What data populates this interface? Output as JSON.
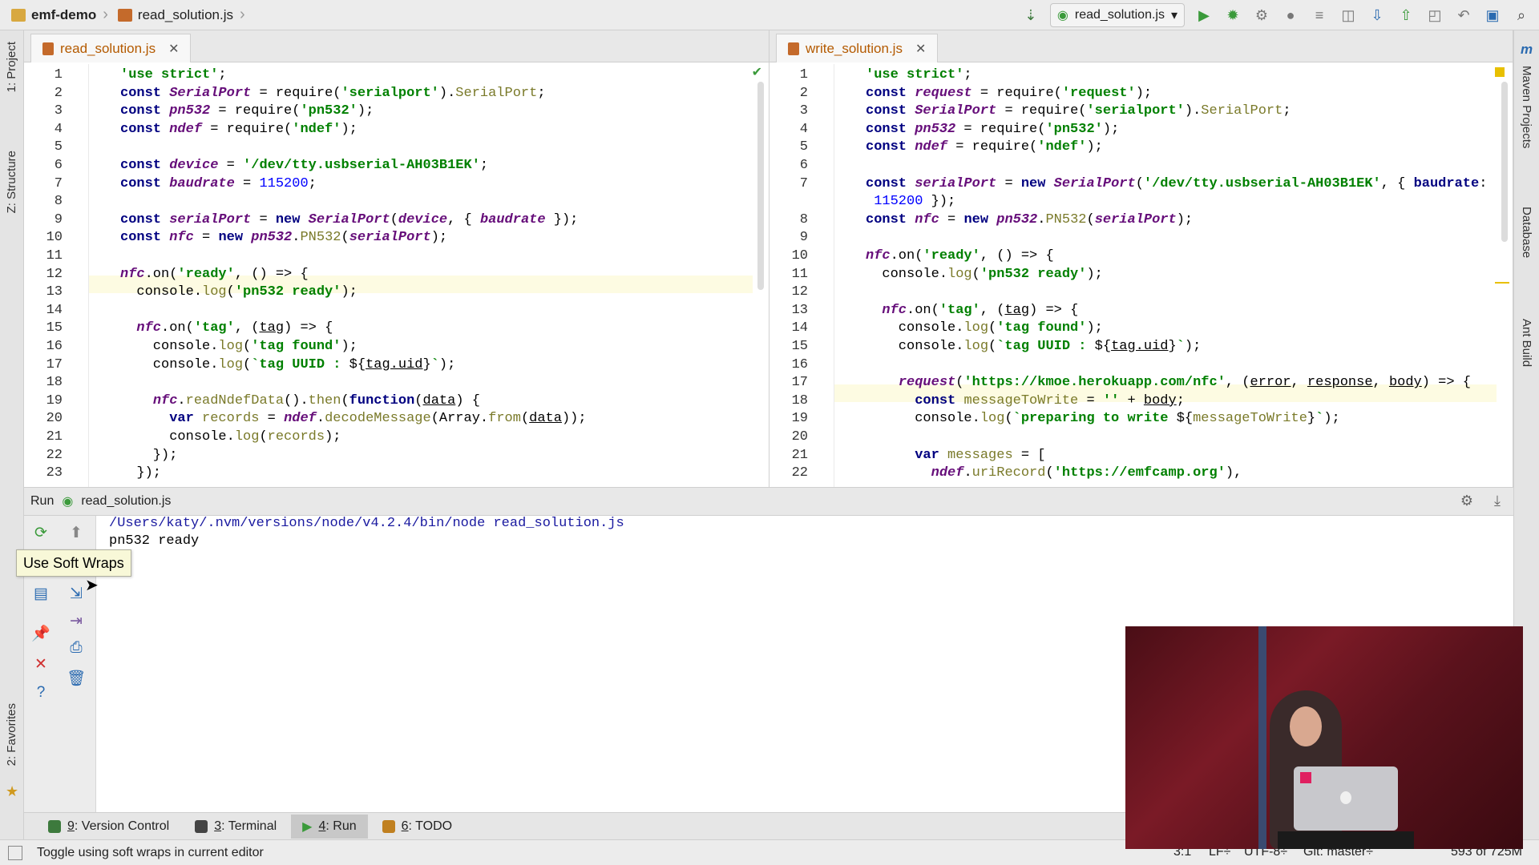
{
  "navbar": {
    "project": "emf-demo",
    "file": "read_solution.js",
    "run_config": "read_solution.js"
  },
  "left_strip": {
    "project": "1: Project",
    "structure": "Z: Structure",
    "favorites": "2: Favorites"
  },
  "right_strip": {
    "maven": "Maven Projects",
    "database": "Database",
    "ant": "Ant Build"
  },
  "left_editor": {
    "tab": "read_solution.js",
    "lines": [
      {
        "n": "1",
        "html": "<span class='str'>'use strict'</span>;"
      },
      {
        "n": "2",
        "html": "<span class='kw'>const</span> <span class='it'>SerialPort</span> = require(<span class='str'>'serialport'</span>).<span class='fn'>SerialPort</span>;"
      },
      {
        "n": "3",
        "html": "<span class='kw'>const</span> <span class='it'>pn532</span> = require(<span class='str'>'pn532'</span>);"
      },
      {
        "n": "4",
        "html": "<span class='kw'>const</span> <span class='it'>ndef</span> = require(<span class='str'>'ndef'</span>);"
      },
      {
        "n": "5",
        "html": ""
      },
      {
        "n": "6",
        "html": "<span class='kw'>const</span> <span class='it'>device</span> = <span class='str'>'/dev/tty.usbserial-AH03B1EK'</span>;"
      },
      {
        "n": "7",
        "html": "<span class='kw'>const</span> <span class='it'>baudrate</span> = <span class='num'>115200</span>;"
      },
      {
        "n": "8",
        "html": ""
      },
      {
        "n": "9",
        "html": "<span class='kw'>const</span> <span class='it'>serialPort</span> = <span class='kw'>new</span> <span class='it'>SerialPort</span>(<span class='it'>device</span>, { <span class='it'>baudrate</span> });"
      },
      {
        "n": "10",
        "html": "<span class='kw'>const</span> <span class='it'>nfc</span> = <span class='kw'>new</span> <span class='it'>pn532</span>.<span class='fn'>PN532</span>(<span class='it'>serialPort</span>);"
      },
      {
        "n": "11",
        "html": ""
      },
      {
        "n": "12",
        "html": "<span class='it'>nfc</span>.on(<span class='str'>'ready'</span>, () => {"
      },
      {
        "n": "13",
        "html": "  console.<span class='fn'>log</span>(<span class='str'>'pn532 ready'</span>);"
      },
      {
        "n": "14",
        "html": ""
      },
      {
        "n": "15",
        "html": "  <span class='it'>nfc</span>.on(<span class='str'>'tag'</span>, (<span class='u'>tag</span>) => {"
      },
      {
        "n": "16",
        "html": "    console.<span class='fn'>log</span>(<span class='str'>'tag found'</span>);"
      },
      {
        "n": "17",
        "html": "    console.<span class='fn'>log</span>(<span class='str'>`tag UUID : </span>${<span class='u'>tag.uid</span>}<span class='str'>`</span>);"
      },
      {
        "n": "18",
        "html": ""
      },
      {
        "n": "19",
        "html": "    <span class='it'>nfc</span>.<span class='fn'>readNdefData</span>().<span class='fn'>then</span>(<span class='kw'>function</span>(<span class='u'>data</span>) {"
      },
      {
        "n": "20",
        "html": "      <span class='kw'>var</span> <span class='fn'>records</span> = <span class='it'>ndef</span>.<span class='fn'>decodeMessage</span>(Array.<span class='fn'>from</span>(<span class='u'>data</span>));"
      },
      {
        "n": "21",
        "html": "      console.<span class='fn'>log</span>(<span class='fn'>records</span>);"
      },
      {
        "n": "22",
        "html": "    });"
      },
      {
        "n": "23",
        "html": "  });"
      }
    ]
  },
  "right_editor": {
    "tab": "write_solution.js",
    "lines": [
      {
        "n": "1",
        "html": "<span class='str'>'use strict'</span>;"
      },
      {
        "n": "2",
        "html": "<span class='kw'>const</span> <span class='it'>request</span> = require(<span class='str'>'request'</span>);"
      },
      {
        "n": "3",
        "html": "<span class='kw'>const</span> <span class='it'>SerialPort</span> = require(<span class='str'>'serialport'</span>).<span class='fn'>SerialPort</span>;"
      },
      {
        "n": "4",
        "html": "<span class='kw'>const</span> <span class='it'>pn532</span> = require(<span class='str'>'pn532'</span>);"
      },
      {
        "n": "5",
        "html": "<span class='kw'>const</span> <span class='it'>ndef</span> = require(<span class='str'>'ndef'</span>);"
      },
      {
        "n": "6",
        "html": ""
      },
      {
        "n": "7",
        "html": "<span class='kw'>const</span> <span class='it'>serialPort</span> = <span class='kw'>new</span> <span class='it'>SerialPort</span>(<span class='str'>'/dev/tty.usbserial-AH03B1EK'</span>, { <span class='kw'>baudrate</span>:"
      },
      {
        "n": "",
        "html": " <span class='num'>115200</span> });"
      },
      {
        "n": "8",
        "html": "<span class='kw'>const</span> <span class='it'>nfc</span> = <span class='kw'>new</span> <span class='it'>pn532</span>.<span class='fn'>PN532</span>(<span class='it'>serialPort</span>);"
      },
      {
        "n": "9",
        "html": ""
      },
      {
        "n": "10",
        "html": "<span class='it'>nfc</span>.on(<span class='str'>'ready'</span>, () => {"
      },
      {
        "n": "11",
        "html": "  console.<span class='fn'>log</span>(<span class='str'>'pn532 ready'</span>);"
      },
      {
        "n": "12",
        "html": ""
      },
      {
        "n": "13",
        "html": "  <span class='it'>nfc</span>.on(<span class='str'>'tag'</span>, (<span class='u'>tag</span>) => {"
      },
      {
        "n": "14",
        "html": "    console.<span class='fn'>log</span>(<span class='str'>'tag found'</span>);"
      },
      {
        "n": "15",
        "html": "    console.<span class='fn'>log</span>(<span class='str'>`tag UUID : </span>${<span class='u'>tag.uid</span>}<span class='str'>`</span>);"
      },
      {
        "n": "16",
        "html": ""
      },
      {
        "n": "17",
        "html": "    <span class='it'>request</span>(<span class='str'>'https://kmoe.herokuapp.com/nfc'</span>, (<span class='u'>error</span>, <span class='u'>response</span>, <span class='u'>body</span>) => {"
      },
      {
        "n": "18",
        "html": "      <span class='kw'>const</span> <span class='fn'>messageToWrite</span> = <span class='str'>''</span> + <span class='u'>body</span>;"
      },
      {
        "n": "19",
        "html": "      console.<span class='fn'>log</span>(<span class='str'>`preparing to write </span>${<span class='fn'>messageToWrite</span>}<span class='str'>`</span>);"
      },
      {
        "n": "20",
        "html": ""
      },
      {
        "n": "21",
        "html": "      <span class='kw'>var</span> <span class='fn'>messages</span> = ["
      },
      {
        "n": "22",
        "html": "        <span class='it'>ndef</span>.<span class='fn'>uriRecord</span>(<span class='str'>'https://emfcamp.org'</span>),"
      }
    ]
  },
  "run_panel": {
    "label": "Run",
    "config": "read_solution.js",
    "console": [
      "/Users/katy/.nvm/versions/node/v4.2.4/bin/node read_solution.js",
      "pn532 ready"
    ],
    "tooltip": "Use Soft Wraps"
  },
  "bottom_tools": [
    {
      "key": "9",
      "label": ": Version Control",
      "color": "#3d7a3d"
    },
    {
      "key": "3",
      "label": ": Terminal",
      "color": "#444444"
    },
    {
      "key": "4",
      "label": ": Run",
      "color": "#3a9a3a"
    },
    {
      "key": "6",
      "label": ": TODO",
      "color": "#c08020"
    }
  ],
  "status": {
    "message": "Toggle using soft wraps in current editor",
    "position": "3:1",
    "line_sep": "LF÷",
    "encoding": "UTF-8÷",
    "git": "Git: master÷",
    "memory": "593 of 725M"
  },
  "colors": {
    "accent_orange": "#b45a00",
    "keyword_blue": "#000080",
    "string_green": "#008000",
    "highlight_line": "#fdfbe2"
  }
}
